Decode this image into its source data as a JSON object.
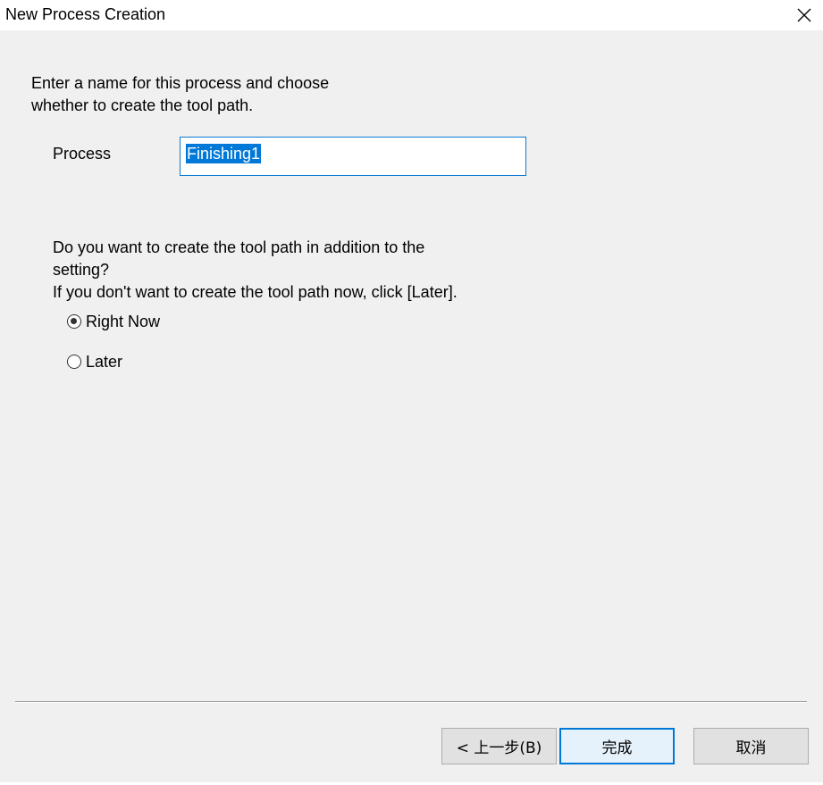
{
  "window": {
    "title": "New Process Creation",
    "close_icon": "close-icon"
  },
  "intro": {
    "line1": "Enter a name for this process and choose",
    "line2": "whether to create the tool path."
  },
  "process": {
    "label": "Process",
    "value": "Finishing1",
    "selected": true
  },
  "question": {
    "line1": "Do you want to create the tool path in addition to the",
    "line2": "setting?",
    "line3": "If you don't want to create the tool path now, click [Later]."
  },
  "options": [
    {
      "label": "Right Now",
      "checked": true
    },
    {
      "label": "Later",
      "checked": false
    }
  ],
  "buttons": {
    "back": "< 上一步(B)",
    "finish": "完成",
    "cancel": "取消"
  },
  "colors": {
    "accent": "#0078d7",
    "background": "#f0f0f0"
  }
}
